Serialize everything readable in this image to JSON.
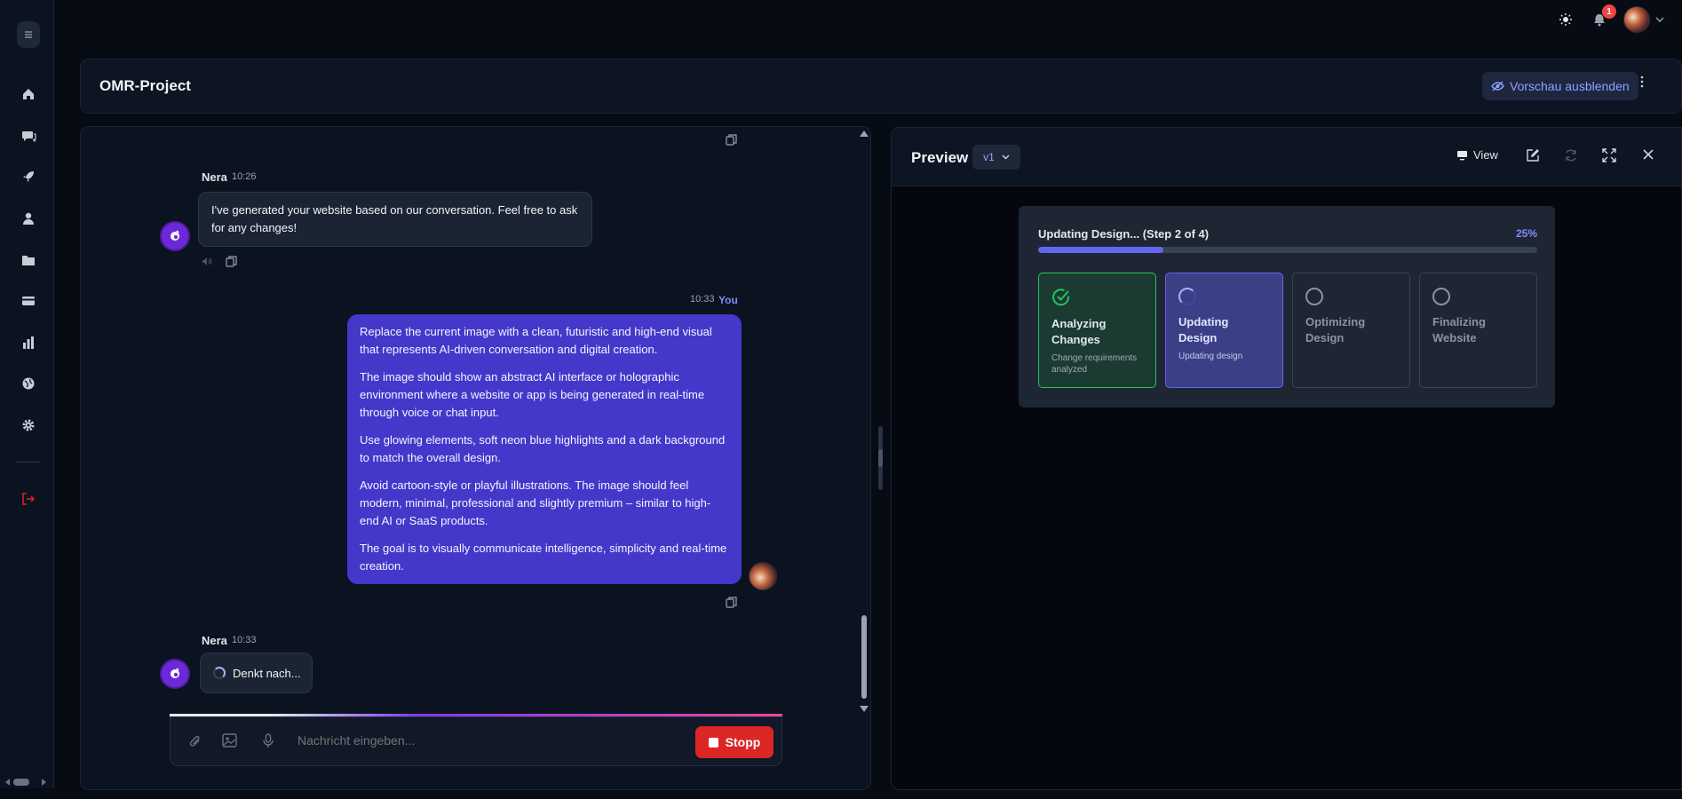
{
  "project": {
    "title": "OMR-Project",
    "hide_preview_label": "Vorschau ausblenden"
  },
  "topbar": {
    "notification_count": "1"
  },
  "chat": {
    "messages": [
      {
        "author": "Nera",
        "time": "10:26",
        "text": "I've generated your website based on our conversation. Feel free to ask for any changes!"
      },
      {
        "author": "You",
        "time": "10:33",
        "paragraphs": [
          "Replace the current image with a clean, futuristic and high-end visual that represents AI-driven conversation and digital creation.",
          "The image should show an abstract AI interface or holographic environment where a website or app is being generated in real-time through voice or chat input.",
          "Use glowing elements, soft neon blue highlights and a dark background to match the overall design.",
          "Avoid cartoon-style or playful illustrations. The image should feel modern, minimal, professional and slightly premium – similar to high-end AI or SaaS products.",
          "The goal is to visually communicate intelligence, simplicity and real-time creation."
        ]
      },
      {
        "author": "Nera",
        "time": "10:33",
        "text": "Denkt nach..."
      }
    ],
    "composer": {
      "placeholder": "Nachricht eingeben...",
      "stop_label": "Stopp"
    }
  },
  "preview": {
    "title": "Preview",
    "version": "v1",
    "view_label": "View",
    "progress": {
      "title": "Updating Design... (Step 2 of 4)",
      "percent_label": "25%",
      "percent": 25,
      "steps": [
        {
          "label": "Analyzing Changes",
          "sub": "Change requirements analyzed",
          "state": "done"
        },
        {
          "label": "Updating Design",
          "sub": "Updating design",
          "state": "active"
        },
        {
          "label": "Optimizing Design",
          "sub": "",
          "state": "pending"
        },
        {
          "label": "Finalizing Website",
          "sub": "",
          "state": "pending"
        }
      ]
    }
  },
  "colors": {
    "accent": "#6366f1",
    "user_bubble": "#4338ca",
    "stop": "#dc2626",
    "success": "#22c55e"
  }
}
